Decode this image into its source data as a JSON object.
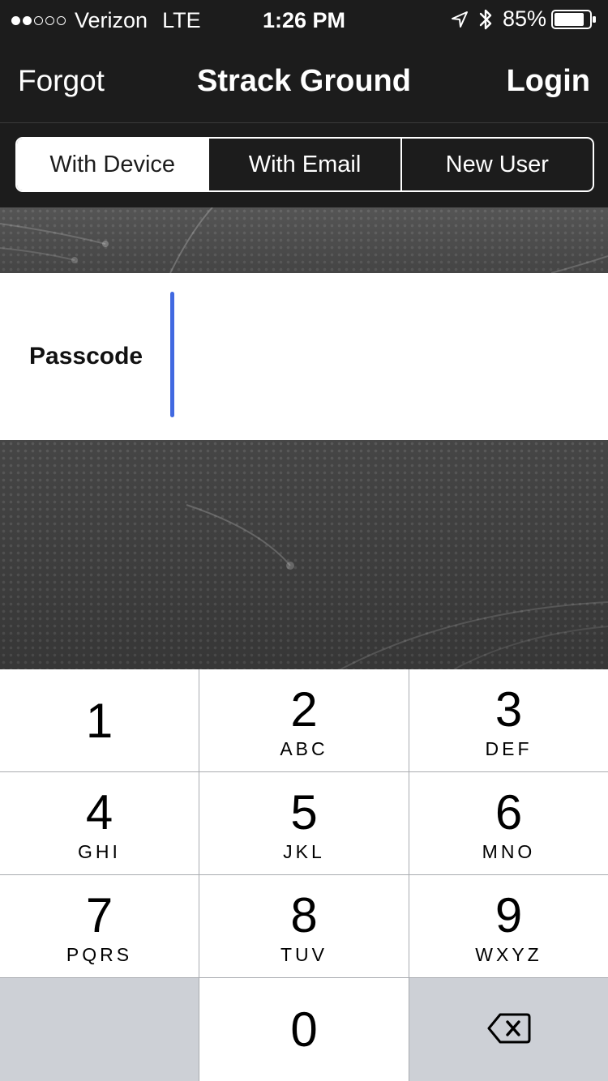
{
  "status_bar": {
    "carrier": "Verizon",
    "network": "LTE",
    "time": "1:26 PM",
    "battery": "85%",
    "signal_bars_filled": 2,
    "signal_bars_total": 5,
    "icons": [
      "location-arrow-icon",
      "bluetooth-icon",
      "battery-icon"
    ]
  },
  "nav": {
    "left_label": "Forgot",
    "title": "Strack Ground",
    "right_label": "Login"
  },
  "segments": [
    {
      "label": "With Device",
      "active": true
    },
    {
      "label": "With Email",
      "active": false
    },
    {
      "label": "New User",
      "active": false
    }
  ],
  "form": {
    "passcode_label": "Passcode",
    "passcode_value": ""
  },
  "keypad": {
    "keys": [
      {
        "num": "1",
        "letters": ""
      },
      {
        "num": "2",
        "letters": "ABC"
      },
      {
        "num": "3",
        "letters": "DEF"
      },
      {
        "num": "4",
        "letters": "GHI"
      },
      {
        "num": "5",
        "letters": "JKL"
      },
      {
        "num": "6",
        "letters": "MNO"
      },
      {
        "num": "7",
        "letters": "PQRS"
      },
      {
        "num": "8",
        "letters": "TUV"
      },
      {
        "num": "9",
        "letters": "WXYZ"
      },
      {
        "num": "0",
        "letters": ""
      }
    ],
    "delete_icon": "backspace-icon"
  },
  "colors": {
    "background": "#1c1c1c",
    "caret": "#4169e1",
    "keypad_key": "#ffffff",
    "keypad_dark_key": "#cdd0d6"
  }
}
